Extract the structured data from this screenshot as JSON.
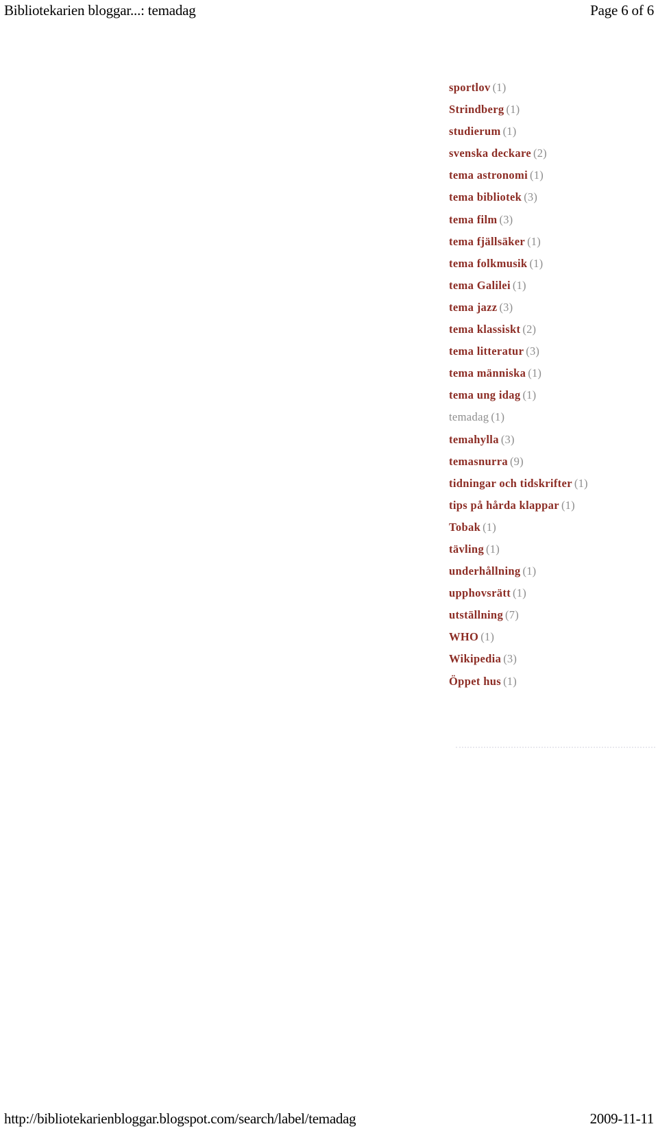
{
  "header": {
    "title": "Bibliotekarien bloggar...: temadag",
    "page_indicator": "Page 6 of 6"
  },
  "labels": {
    "items": [
      {
        "name": "sportlov",
        "count": "(1)",
        "current": false
      },
      {
        "name": "Strindberg",
        "count": "(1)",
        "current": false
      },
      {
        "name": "studierum",
        "count": "(1)",
        "current": false
      },
      {
        "name": "svenska deckare",
        "count": "(2)",
        "current": false
      },
      {
        "name": "tema astronomi",
        "count": "(1)",
        "current": false
      },
      {
        "name": "tema bibliotek",
        "count": "(3)",
        "current": false
      },
      {
        "name": "tema film",
        "count": "(3)",
        "current": false
      },
      {
        "name": "tema fjällsäker",
        "count": "(1)",
        "current": false
      },
      {
        "name": "tema folkmusik",
        "count": "(1)",
        "current": false
      },
      {
        "name": "tema Galilei",
        "count": "(1)",
        "current": false
      },
      {
        "name": "tema jazz",
        "count": "(3)",
        "current": false
      },
      {
        "name": "tema klassiskt",
        "count": "(2)",
        "current": false
      },
      {
        "name": "tema litteratur",
        "count": "(3)",
        "current": false
      },
      {
        "name": "tema människa",
        "count": "(1)",
        "current": false
      },
      {
        "name": "tema ung idag",
        "count": "(1)",
        "current": false
      },
      {
        "name": "temadag",
        "count": "(1)",
        "current": true
      },
      {
        "name": "temahylla",
        "count": "(3)",
        "current": false
      },
      {
        "name": "temasnurra",
        "count": "(9)",
        "current": false
      },
      {
        "name": "tidningar och tidskrifter",
        "count": "(1)",
        "current": false
      },
      {
        "name": "tips på hårda klappar",
        "count": "(1)",
        "current": false
      },
      {
        "name": "Tobak",
        "count": "(1)",
        "current": false
      },
      {
        "name": "tävling",
        "count": "(1)",
        "current": false
      },
      {
        "name": "underhållning",
        "count": "(1)",
        "current": false
      },
      {
        "name": "upphovsrätt",
        "count": "(1)",
        "current": false
      },
      {
        "name": "utställning",
        "count": "(7)",
        "current": false
      },
      {
        "name": "WHO",
        "count": "(1)",
        "current": false
      },
      {
        "name": "Wikipedia",
        "count": "(3)",
        "current": false
      },
      {
        "name": "Öppet hus",
        "count": "(1)",
        "current": false
      }
    ]
  },
  "footer": {
    "url": "http://bibliotekarienbloggar.blogspot.com/search/label/temadag",
    "date": "2009-11-11"
  },
  "colors": {
    "link": "#8c2c24",
    "muted": "#8d8d8d",
    "divider": "#e8e8ee",
    "text": "#000000",
    "background": "#ffffff"
  }
}
